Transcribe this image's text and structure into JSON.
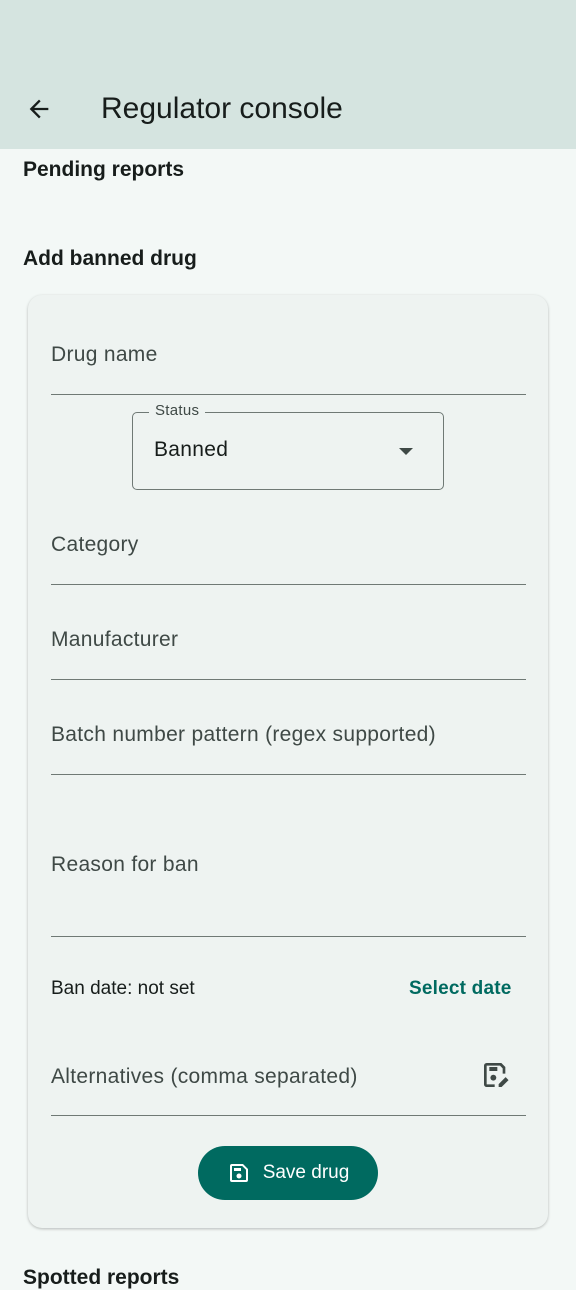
{
  "app_bar": {
    "title": "Regulator console",
    "back_icon": "arrow-back-icon"
  },
  "sections": {
    "pending_reports": "Pending reports",
    "add_banned_drug": "Add banned drug",
    "next_section_partial": "Spotted reports"
  },
  "form": {
    "drug_name_label": "Drug name",
    "status": {
      "label": "Status",
      "value": "Banned",
      "caret_icon": "arrow-drop-down-icon"
    },
    "category_label": "Category",
    "manufacturer_label": "Manufacturer",
    "batch_pattern_label": "Batch number pattern (regex supported)",
    "reason_label": "Reason for ban",
    "ban_date_text": "Ban date: not set",
    "select_date_label": "Select date",
    "alternatives_label": "Alternatives (comma separated)",
    "alternatives_icon": "save-edit-icon",
    "save_button": {
      "label": "Save drug",
      "icon": "save-icon"
    }
  },
  "colors": {
    "app_bar_bg": "#d5e4e0",
    "page_bg": "#f3f8f6",
    "card_bg": "#eef3f1",
    "primary": "#006a60",
    "outline": "#6f7975"
  }
}
